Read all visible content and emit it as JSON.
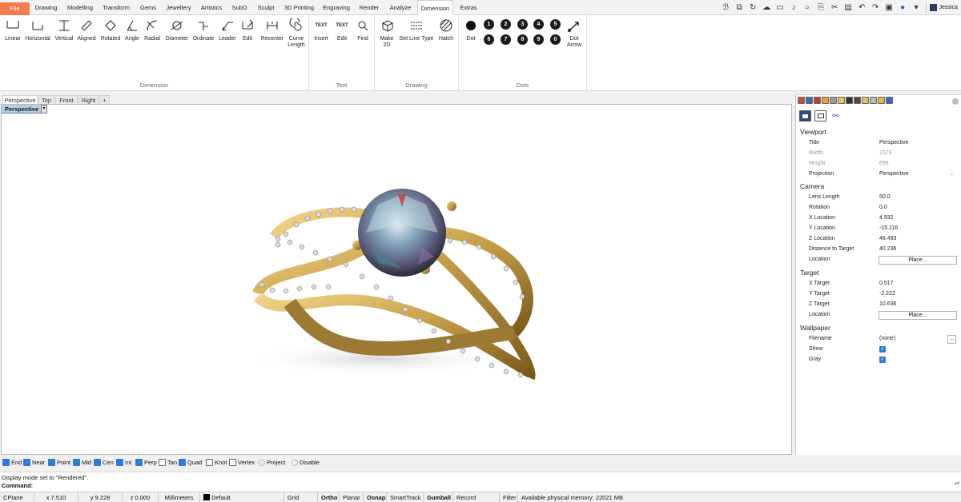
{
  "menu": {
    "tabs": [
      "File",
      "Drawing",
      "Modelling",
      "Transform",
      "Gems",
      "Jewellery",
      "Artistics",
      "SubD",
      "Sculpt",
      "3D Printing",
      "Engraving",
      "Render",
      "Analyze",
      "Dimension",
      "Extras"
    ],
    "active": "Dimension",
    "user": "Jessica"
  },
  "ribbon": {
    "dimension": {
      "title": "Dimension",
      "tools": [
        "Linear",
        "Horizontal",
        "Vertical",
        "Aligned",
        "Rotated",
        "Angle",
        "Radial",
        "Diameter",
        "Ordinate",
        "Leader",
        "Edit",
        "Recenter",
        "Curve Length"
      ]
    },
    "text": {
      "title": "Text",
      "tools": [
        "Insert",
        "Edit",
        "Find"
      ]
    },
    "drawing": {
      "title": "Drawing",
      "tools": [
        "Make 2D",
        "Set Line Type",
        "Hatch"
      ]
    },
    "dots": {
      "title": "Dots",
      "tools": [
        "Dot",
        "Dot Arrow"
      ],
      "numbers": [
        "1",
        "2",
        "3",
        "4",
        "5",
        "6",
        "7",
        "8",
        "9",
        "0"
      ]
    },
    "text_icon_label": "TEXT"
  },
  "viewport_tabs": [
    "Perspective",
    "Top",
    "Front",
    "Right",
    "+"
  ],
  "viewport": {
    "label": "Perspective"
  },
  "panel": {
    "viewport_section": "Viewport",
    "viewport_rows": [
      {
        "k": "Title",
        "v": "Perspective"
      },
      {
        "k": "Width",
        "v": "1579"
      },
      {
        "k": "Height",
        "v": "698"
      },
      {
        "k": "Projection",
        "v": "Perspective"
      }
    ],
    "camera_section": "Camera",
    "camera_rows": [
      {
        "k": "Lens Length",
        "v": "50.0"
      },
      {
        "k": "Rotation",
        "v": "0.0"
      },
      {
        "k": "X Location",
        "v": "4.932"
      },
      {
        "k": "Y Location",
        "v": "-15.116"
      },
      {
        "k": "Z Location",
        "v": "48.493"
      },
      {
        "k": "Distance to Target",
        "v": "40.236"
      },
      {
        "k": "Location",
        "v": "Place..."
      }
    ],
    "target_section": "Target",
    "target_rows": [
      {
        "k": "X Target",
        "v": "0.517"
      },
      {
        "k": "Y Target",
        "v": "-2.222"
      },
      {
        "k": "Z Target",
        "v": "10.636"
      },
      {
        "k": "Location",
        "v": "Place..."
      }
    ],
    "wallpaper_section": "Wallpaper",
    "wallpaper_rows": [
      {
        "k": "Filename",
        "v": "(none)"
      },
      {
        "k": "Show",
        "v": "checked"
      },
      {
        "k": "Gray",
        "v": "checked"
      }
    ],
    "ellipsis": "...",
    "dropdown": "⌄"
  },
  "osnap": [
    {
      "label": "End",
      "on": true
    },
    {
      "label": "Near",
      "on": true
    },
    {
      "label": "Point",
      "on": true
    },
    {
      "label": "Mid",
      "on": true
    },
    {
      "label": "Cen",
      "on": true
    },
    {
      "label": "Int",
      "on": true
    },
    {
      "label": "Perp",
      "on": true
    },
    {
      "label": "Tan",
      "on": false
    },
    {
      "label": "Quad",
      "on": true
    },
    {
      "label": "Knot",
      "on": false
    },
    {
      "label": "Vertex",
      "on": false
    },
    {
      "label": "Project",
      "on": false
    },
    {
      "label": "Disable",
      "on": false
    }
  ],
  "command": {
    "history": "Display mode set to \"Rendered\".",
    "prompt": "Command:"
  },
  "status": {
    "cplane": "CPlane",
    "x": "x 7.510",
    "y": "y 9.228",
    "z": "z 0.000",
    "units": "Millimeters",
    "layer": "Default",
    "items": [
      "Grid Snap",
      "Ortho",
      "Planar",
      "Osnap",
      "SmartTrack",
      "Gumball",
      "Record History",
      "Filter"
    ],
    "memory": "Available physical memory: 22021 MB"
  },
  "colors": {
    "file_tab": "#f27d4c",
    "accent": "#2d7dd6",
    "viewport_label": "#b8cde2",
    "gold": "#c9a24a"
  }
}
